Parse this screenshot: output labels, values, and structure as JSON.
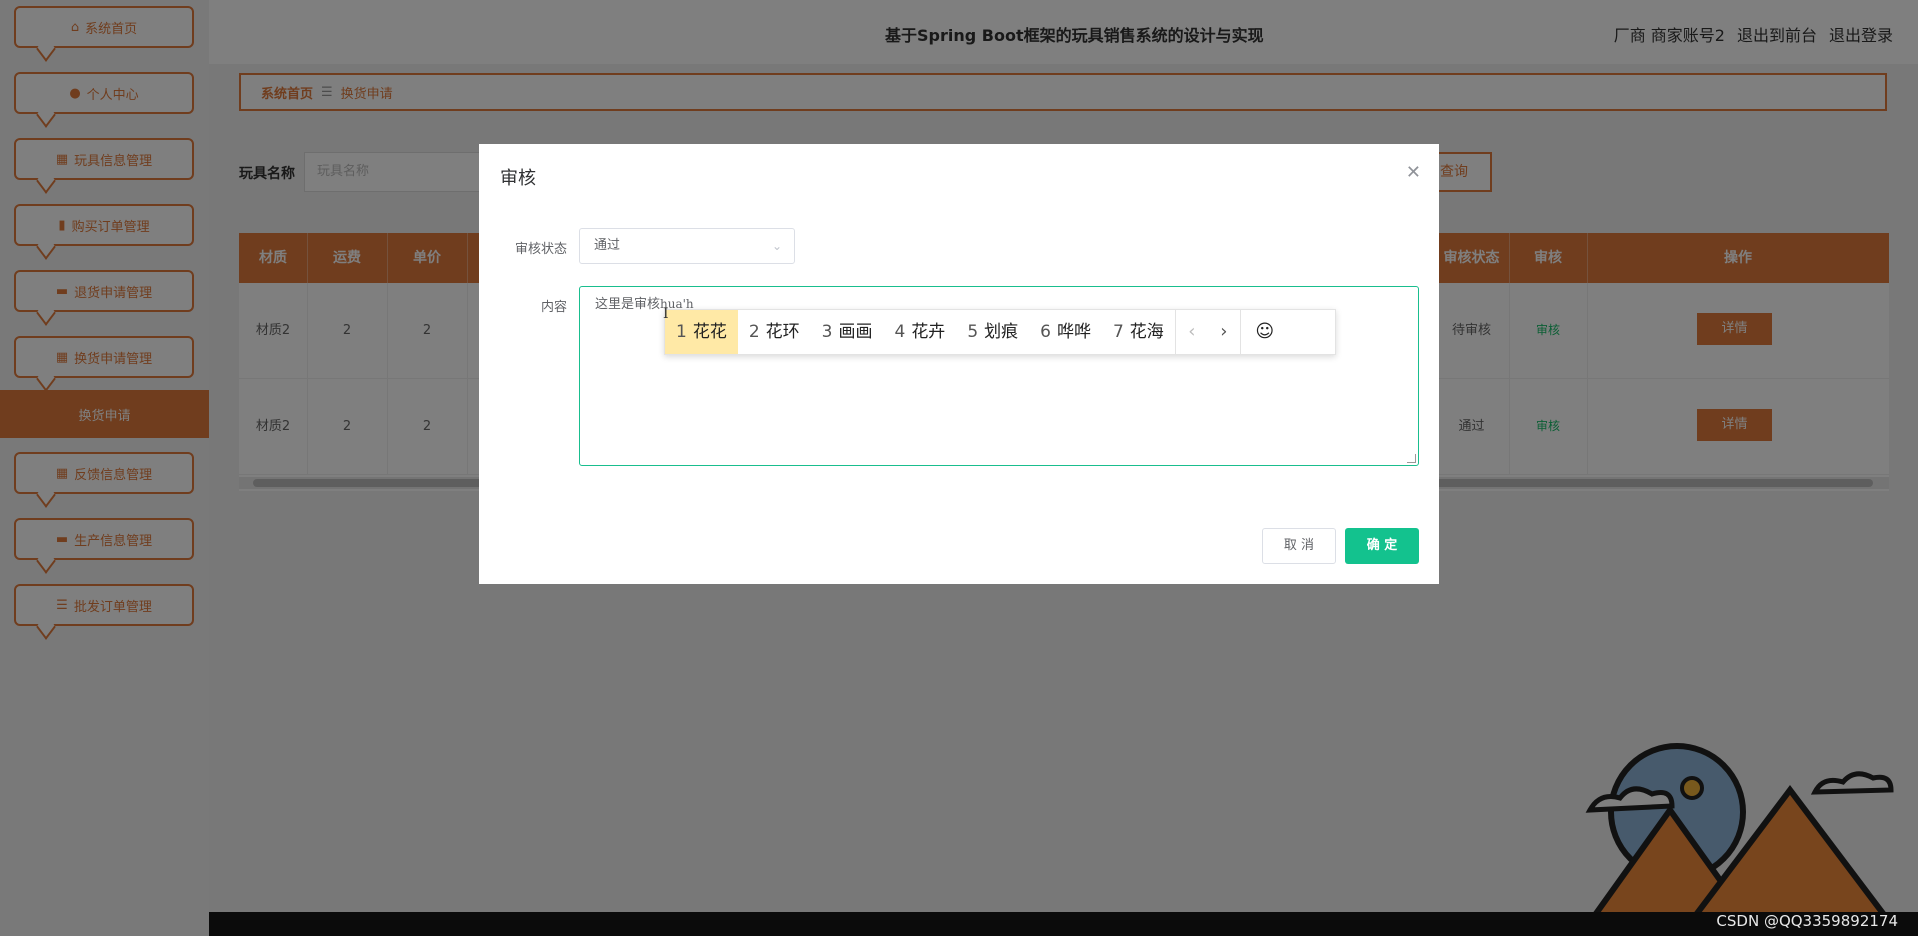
{
  "app": {
    "title": "基于Spring Boot框架的玩具销售系统的设计与实现",
    "user": "厂商 商家账号2",
    "to_front": "退出到前台",
    "logout": "退出登录"
  },
  "sidebar": {
    "items": [
      {
        "label": "系统首页",
        "icon": "home-icon",
        "glyph": "⌂"
      },
      {
        "label": "个人中心",
        "icon": "user-icon",
        "glyph": "●"
      },
      {
        "label": "玩具信息管理",
        "icon": "grid-icon",
        "glyph": "▦"
      },
      {
        "label": "购买订单管理",
        "icon": "book-icon",
        "glyph": "▮"
      },
      {
        "label": "退货申请管理",
        "icon": "message-icon",
        "glyph": "▬"
      },
      {
        "label": "换货申请管理",
        "icon": "grid-icon",
        "glyph": "▦"
      },
      {
        "label": "反馈信息管理",
        "icon": "grid-icon",
        "glyph": "▦"
      },
      {
        "label": "生产信息管理",
        "icon": "message-icon",
        "glyph": "▬"
      },
      {
        "label": "批发订单管理",
        "icon": "sliders-icon",
        "glyph": "☰"
      }
    ],
    "active_sub": "换货申请"
  },
  "breadcrumb": {
    "home": "系统首页",
    "sep": "☰",
    "current": "换货申请"
  },
  "search": {
    "label": "玩具名称",
    "placeholder": "玩具名称",
    "button": "查询"
  },
  "table": {
    "columns_left": [
      "材质",
      "运费",
      "单价"
    ],
    "columns_right": [
      "审核状态",
      "审核",
      "操作"
    ],
    "rows": [
      {
        "material": "材质2",
        "freight": "2",
        "price": "2",
        "status": "待审核",
        "audit": "审核",
        "action": "详情"
      },
      {
        "material": "材质2",
        "freight": "2",
        "price": "2",
        "status": "通过",
        "audit": "审核",
        "action": "详情"
      }
    ]
  },
  "dialog": {
    "title": "审核",
    "status_label": "审核状态",
    "status_value": "通过",
    "content_label": "内容",
    "content_value": "这里是审核",
    "composing": "hua'h",
    "cancel": "取 消",
    "confirm": "确 定"
  },
  "ime": {
    "candidates": [
      {
        "n": "1",
        "text": "花花"
      },
      {
        "n": "2",
        "text": "花环"
      },
      {
        "n": "3",
        "text": "画画"
      },
      {
        "n": "4",
        "text": "花卉"
      },
      {
        "n": "5",
        "text": "划痕"
      },
      {
        "n": "6",
        "text": "哗哗"
      },
      {
        "n": "7",
        "text": "花海"
      }
    ],
    "prev": "‹",
    "next": "›",
    "emoji": "☺"
  },
  "watermark": "CSDN @QQ3359892174",
  "colors": {
    "accent": "#e07b3c",
    "confirm": "#13c28e",
    "audit_green": "#19be6b"
  }
}
